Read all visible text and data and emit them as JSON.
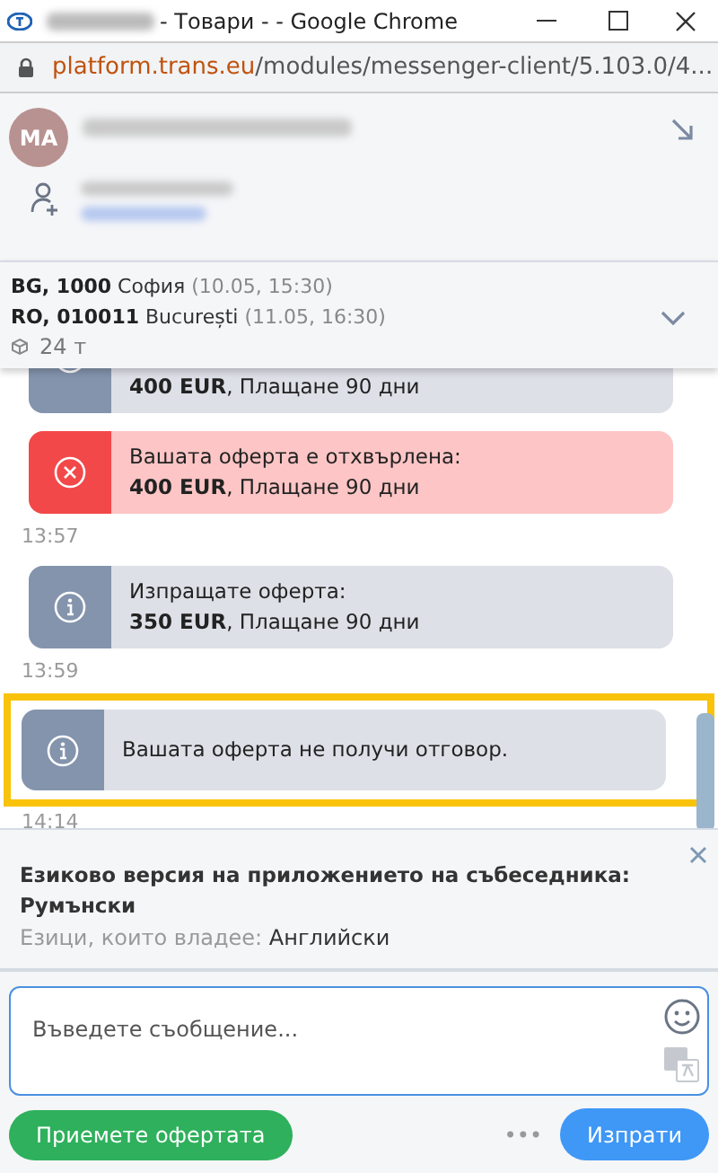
{
  "window": {
    "title": "- Товари - - Google Chrome"
  },
  "address_bar": {
    "domain": "platform.trans.eu",
    "path": "/modules/messenger-client/5.103.0/4..."
  },
  "contact": {
    "initials": "MA"
  },
  "route": {
    "stops": [
      {
        "code": "BG, 1000",
        "city": "София",
        "time": "(10.05, 15:30)"
      },
      {
        "code": "RO, 010011",
        "city": "București",
        "time": "(11.05, 16:30)"
      }
    ],
    "weight": "24 т",
    "expanded": false
  },
  "messages": [
    {
      "kind": "info",
      "lines": [
        "**400 EUR**, Плащане 90 дни"
      ],
      "highlighted": false
    },
    {
      "kind": "rejected",
      "lines": [
        "Вашата оферта е отхвърлена:",
        "**400 EUR**, Плащане 90 дни"
      ],
      "highlighted": false,
      "time": "13:57"
    },
    {
      "kind": "info",
      "lines": [
        "Изпращате оферта:",
        "**350 EUR**, Плащане 90 дни"
      ],
      "highlighted": false,
      "time": "13:59"
    },
    {
      "kind": "info",
      "lines": [
        "Вашата оферта не получи отговор."
      ],
      "highlighted": true,
      "time": "14:14"
    }
  ],
  "language_notice": {
    "title": "Езиково версия на приложението на събеседника: Румънски",
    "languages_label": "Езици, които владее:",
    "languages": "Английски"
  },
  "composer": {
    "placeholder": "Въведете съобщение..."
  },
  "actions": {
    "accept": "Приемете офертата",
    "more": "•••",
    "send": "Изпрати"
  }
}
